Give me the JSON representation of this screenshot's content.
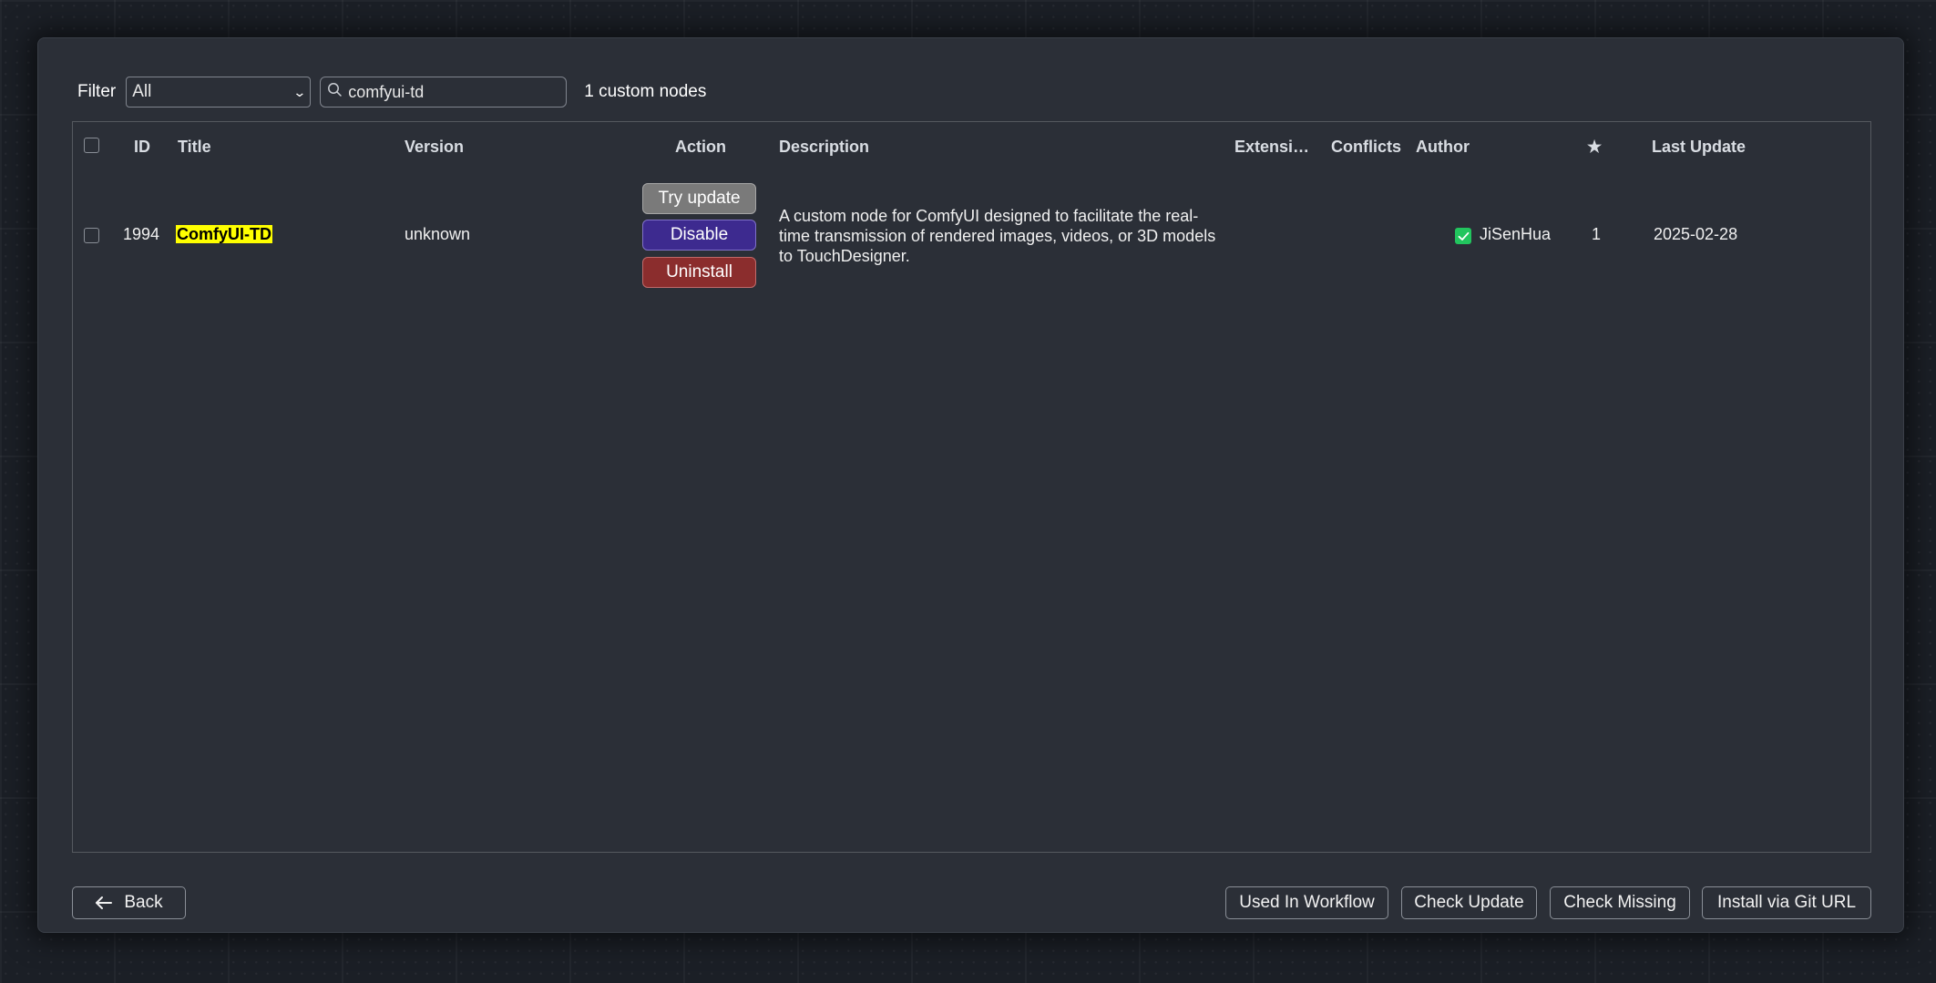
{
  "filter": {
    "label": "Filter",
    "selected": "All",
    "search_value": "comfyui-td",
    "count_text": "1 custom nodes"
  },
  "table": {
    "headers": {
      "id": "ID",
      "title": "Title",
      "version": "Version",
      "action": "Action",
      "description": "Description",
      "extensions": "Extensi…",
      "conflicts": "Conflicts",
      "author": "Author",
      "stars": "★",
      "last_update": "Last Update"
    },
    "rows": [
      {
        "id": "1994",
        "title": "ComfyUI-TD",
        "version": "unknown",
        "actions": {
          "try_update": "Try update",
          "disable": "Disable",
          "uninstall": "Uninstall"
        },
        "description": "A custom node for ComfyUI designed to facilitate the real-time transmission of rendered images, videos, or 3D models to TouchDesigner.",
        "author": "JiSenHua",
        "author_verified": true,
        "stars": "1",
        "last_update": "2025-02-28"
      }
    ]
  },
  "footer": {
    "back": "Back",
    "used_in_workflow": "Used In Workflow",
    "check_update": "Check Update",
    "check_missing": "Check Missing",
    "install_git": "Install via Git URL"
  },
  "colors": {
    "title_highlight": "#ffff00",
    "try_update_bg": "#7a7a7a",
    "disable_bg": "#3d2a8f",
    "uninstall_bg": "#8b2d2d",
    "verified": "#22c55e"
  }
}
